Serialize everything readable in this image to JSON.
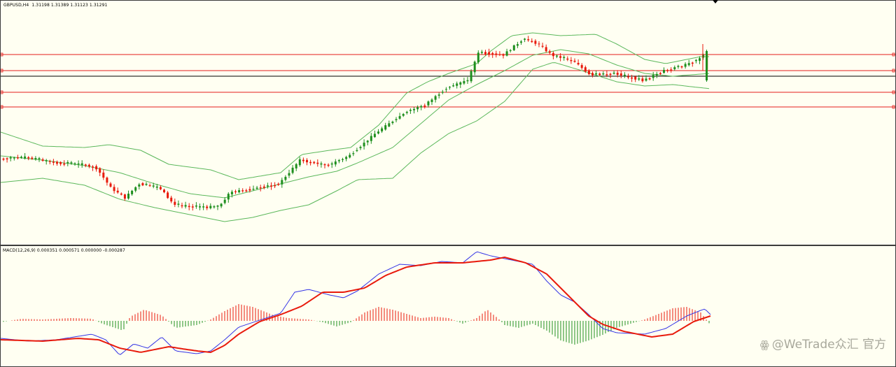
{
  "header": {
    "symbol": "GBPUSD,H4",
    "ohlc": "1.31198 1.31389 1.31123 1.31291"
  },
  "indicator": {
    "label": "MACD(12,26,9) 0.000351 0.000571 0.000000 -0.000287"
  },
  "watermark": {
    "icon": "weibo-icon",
    "text": "@WeTrade众汇 官方"
  },
  "colors": {
    "background": "#fffff2",
    "bull": "#1f8f1f",
    "bear": "#e81a0c",
    "bands": "#5cb85c",
    "hlines": "#e51c1c",
    "macd_line": "#3535e6",
    "signal_line": "#e81a0c"
  },
  "chart_data": [
    {
      "type": "candlestick",
      "symbol": "GBPUSD",
      "timeframe": "H4",
      "last_bar": {
        "open": 1.31198,
        "high": 1.31389,
        "low": 1.31123,
        "close": 1.31291
      },
      "overlays": [
        "Bollinger Bands",
        "horizontal lines (5)"
      ],
      "grid": false
    },
    {
      "type": "macd",
      "params": [
        12,
        26,
        9
      ],
      "values": {
        "macd": 0.000351,
        "signal": 0.000571,
        "histogram_1": 0.0,
        "histogram_2": -0.000287
      },
      "series": [
        {
          "name": "MACD",
          "color": "#3535e6"
        },
        {
          "name": "Signal",
          "color": "#e81a0c"
        }
      ]
    }
  ]
}
